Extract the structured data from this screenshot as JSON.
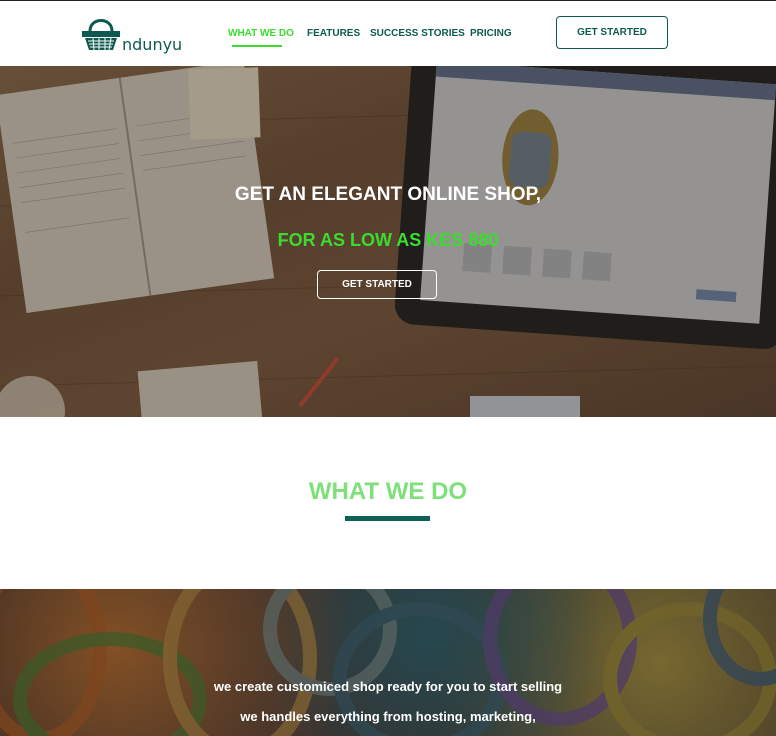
{
  "header": {
    "logo_text": "ndunyu",
    "nav": [
      {
        "label": "WHAT WE DO",
        "active": true
      },
      {
        "label": "FEATURES",
        "active": false
      },
      {
        "label": "SUCCESS STORIES",
        "active": false
      },
      {
        "label": "PRICING",
        "active": false
      }
    ],
    "cta_label": "GET STARTED"
  },
  "hero": {
    "title": "GET AN ELEGANT ONLINE SHOP,",
    "subtitle": "FOR AS LOW AS KES 880",
    "cta_label": "GET STARTED"
  },
  "what_we_do": {
    "title": "WHAT WE DO",
    "lines": [
      "we create customiced shop ready for you to start selling",
      "we handles everything from hosting, marketing,"
    ]
  },
  "colors": {
    "brand_dark": "#0e5a4f",
    "accent_green": "#3bdc2f",
    "heading_green": "#7ee07a"
  }
}
